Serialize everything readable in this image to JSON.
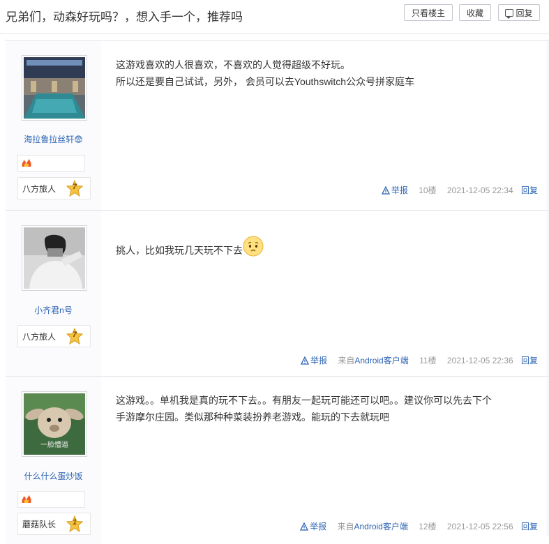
{
  "header": {
    "title": "兄弟们，动森好玩吗？，想入手一个，推荐吗",
    "only_op_label": "只看楼主",
    "favorite_label": "收藏",
    "reply_label": "回复"
  },
  "posts": [
    {
      "author": "海拉鲁拉丝轩😨",
      "badge_icon": "fire-badge-icon",
      "level_name": "八方旅人",
      "level": "7",
      "content_lines": [
        "这游戏喜欢的人很喜欢，不喜欢的人觉得超级不好玩。",
        "所以还是要自己试试，另外， 会员可以去Youthswitch公众号拼家庭车"
      ],
      "report": "举报",
      "source_prefix": "",
      "source": "",
      "floor": "10楼",
      "time": "2021-12-05 22:34",
      "reply": "回复"
    },
    {
      "author": "小齐君n号",
      "level_name": "八方旅人",
      "level": "7",
      "content_lines": [
        "挑人，比如我玩几天玩不下去"
      ],
      "emoji": "pleading-face-emoji",
      "report": "举报",
      "source_prefix": "来自",
      "source": "Android客户端",
      "floor": "11楼",
      "time": "2021-12-05 22:36",
      "reply": "回复"
    },
    {
      "author": "什么什么蛋炒饭",
      "badge_icon": "fire-badge-icon",
      "level_name": "蘑菇队长",
      "level": "1",
      "content_lines": [
        "这游戏。。单机我是真的玩不下去。。有朋友一起玩可能还可以吧。。建议你可以先去下个",
        "手游摩尔庄园。类似那种种菜装扮养老游戏。能玩的下去就玩吧"
      ],
      "avatar_caption": "一脸懵逼",
      "report": "举报",
      "source_prefix": "来自",
      "source": "Android客户端",
      "floor": "12楼",
      "time": "2021-12-05 22:56",
      "reply": "回复"
    }
  ],
  "colors": {
    "link": "#2d64b3",
    "meta": "#999999",
    "sidebar": "#fbfbfd",
    "border": "#e1e4e6"
  }
}
